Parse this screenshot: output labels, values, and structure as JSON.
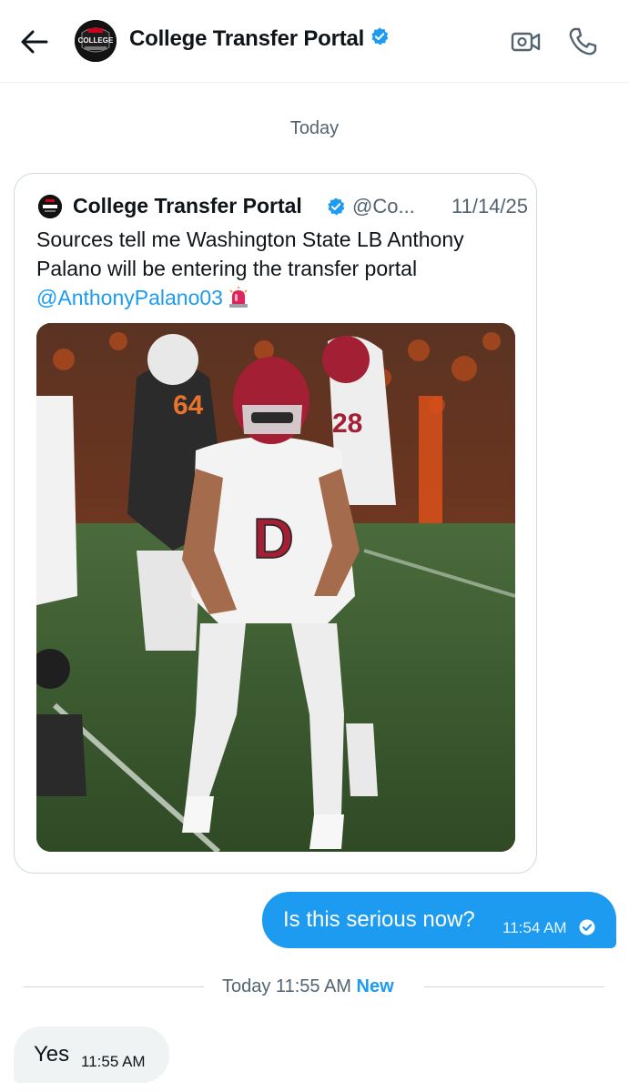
{
  "header": {
    "back_icon": "back-arrow-icon",
    "title": "College Transfer Portal",
    "avatar_text": "COLLEGE",
    "verified_color": "#1d9bf0",
    "video_icon": "video-camera-icon",
    "call_icon": "phone-icon"
  },
  "conversation": {
    "day_label": "Today",
    "shared_post": {
      "author": "College Transfer Portal",
      "handle": "@Co...",
      "date": "11/14/25",
      "text": "Sources tell me Washington State LB Anthony Palano will be entering the transfer portal",
      "mention": "@AnthonyPalano03",
      "emoji_icon": "police-siren-icon",
      "photo_jersey_letter": "D"
    },
    "sent_message": {
      "text": "Is this serious now?",
      "time": "11:54 AM",
      "status_icon": "read-check-icon"
    },
    "divider": {
      "label": "Today 11:55 AM",
      "new_label": "New"
    },
    "received_message": {
      "text": "Yes",
      "time": "11:55 AM"
    }
  },
  "colors": {
    "accent": "#1d9bf0",
    "muted": "#536471",
    "bubble_received": "#eff3f4"
  }
}
